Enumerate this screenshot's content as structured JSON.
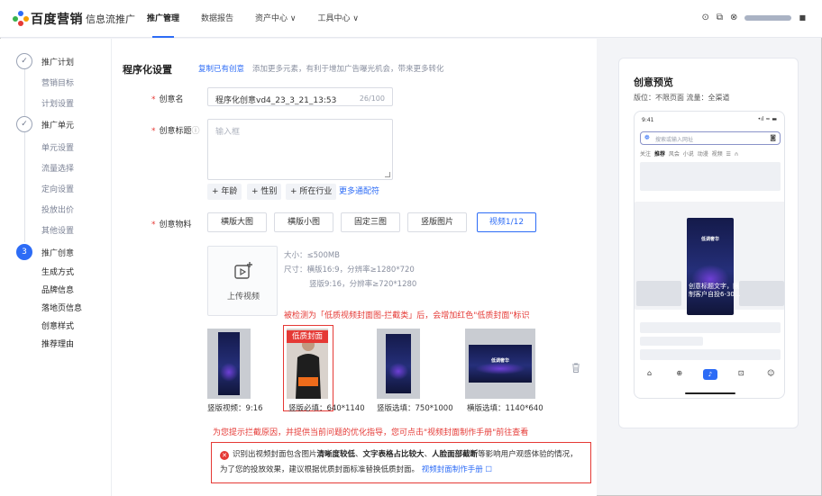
{
  "header": {
    "brand": "百度营销",
    "product": "信息流推广",
    "nav": [
      "推广管理",
      "数据报告",
      "资产中心 ∨",
      "工具中心 ∨"
    ],
    "icons": [
      "help-icon",
      "copy-icon",
      "user-icon"
    ]
  },
  "sidebar": {
    "steps": [
      {
        "num": "✓",
        "title": "推广计划",
        "items": [
          "营销目标",
          "计划设置"
        ]
      },
      {
        "num": "✓",
        "title": "推广单元",
        "items": [
          "单元设置",
          "流量选择",
          "定向设置",
          "投放出价",
          "其他设置"
        ]
      },
      {
        "num": "3",
        "title": "推广创意",
        "items": [
          "生成方式",
          "品牌信息",
          "落地页信息",
          "创意样式",
          "推荐理由"
        ]
      }
    ]
  },
  "main": {
    "title": "程序化设置",
    "copy_link": "复制已有创意",
    "desc": "添加更多元素，有利于增加广告曝光机会，带来更多转化",
    "name_label": "创意名",
    "name_value": "程序化创意vd4_23_3_21_13:53",
    "name_count": "26/100",
    "title_label": "创意标题",
    "title_placeholder": "输入框",
    "tags": [
      "+ 年龄",
      "+ 性别",
      "+ 所在行业"
    ],
    "more_wildcards": "更多通配符",
    "material_label": "创意物料",
    "material_tabs": [
      "横版大图",
      "横版小图",
      "固定三图",
      "竖版图片",
      "视频1/12"
    ],
    "upload_label": "上传视频",
    "specs": [
      "大小：≤500MB",
      "尺寸：横版16:9，分辨率≥1280*720",
      "竖版9:16，分辨率≥720*1280"
    ],
    "note_top": "被检测为「低质视频封面图-拦截类」后，会增加红色\"低质封面\"标识",
    "low_quality_badge": "低质封面",
    "thumbs": [
      {
        "caption": "竖版视频：9:16"
      },
      {
        "caption": "竖版必填：640*1140"
      },
      {
        "caption": "竖版选填：750*1000"
      },
      {
        "caption": "横版选填：1140*640"
      }
    ],
    "poster_text": "低调奢华",
    "note_bottom": "为您提示拦截原因，并提供当前问题的优化指导，您可点击\"视频封面制作手册\"前往查看",
    "warning_pre": "识别出视频封面包含图片",
    "warning_b1": "清晰度较低",
    "warning_mid1": "、",
    "warning_b2": "文字表格占比较大",
    "warning_mid2": "、",
    "warning_b3": "人脸面部截断",
    "warning_post": "等影响用户观感体验的情况，为了您的投放效果，建议根据优质封面标准替换低质封面。",
    "warning_link": "视频封面制作手册 ☐"
  },
  "preview": {
    "title": "创意预览",
    "meta": "版位：不限页面   流量：全渠道",
    "time": "9:41",
    "signal": "•ıl ≈ ▬",
    "search_placeholder": "搜索或输入网址",
    "tabs_pre": "关注",
    "tabs_active": "推荐",
    "tabs_post": "风会  小说  动漫  视频  ☰  ∩",
    "card_text": "创意标题文字，限制客户自投6-30...",
    "bottom_icons": [
      "⌂",
      "⊕",
      "♪",
      "⊡",
      "☺"
    ]
  },
  "colors": {
    "accent": "#2d6cf6",
    "warning": "#e53935"
  }
}
